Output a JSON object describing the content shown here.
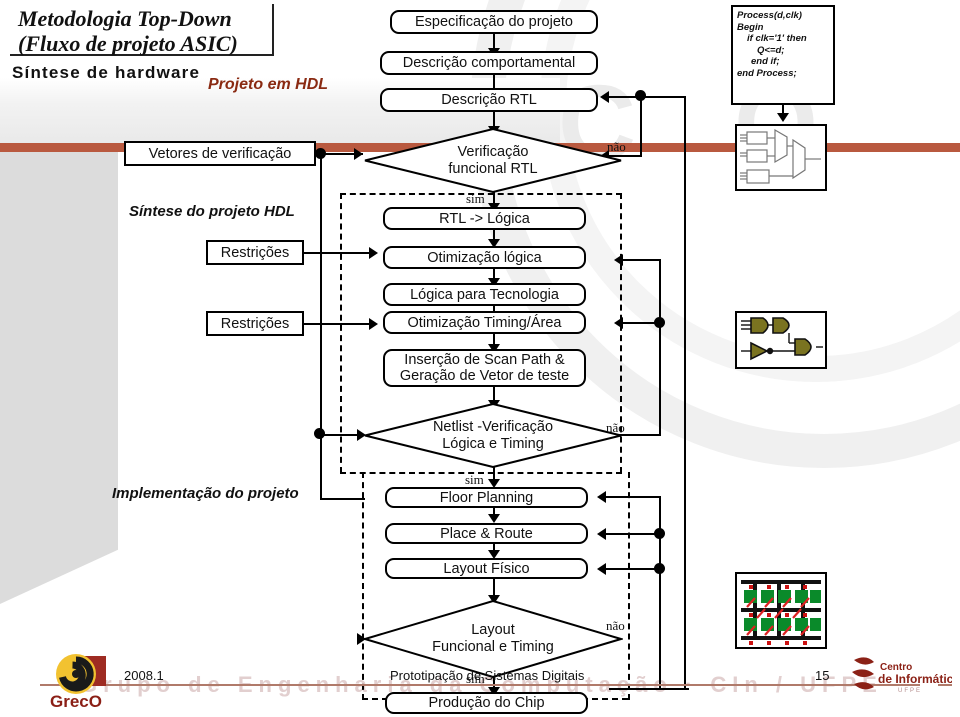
{
  "header": {
    "title_line1": "Metodologia Top-Down",
    "title_line2": "(Fluxo de projeto ASIC)",
    "subtitle": "Síntese de hardware",
    "phase_label": "Projeto em HDL"
  },
  "watermark": {
    "letters": "GRECO",
    "bottom_line": "Grupo  de  Engenharia  da  Computação · CIn / UFPE"
  },
  "side_labels": {
    "sintese": "Síntese do projeto HDL",
    "implementacao": "Implementação do projeto"
  },
  "flow": {
    "especificacao": "Especificação do projeto",
    "descricao_comportamental": "Descrição comportamental",
    "descricao_rtl": "Descrição RTL",
    "vetores": "Vetores de verificação",
    "verificacao_rtl_l1": "Verificação",
    "verificacao_rtl_l2": "funcional RTL",
    "rtl_logica": "RTL -> Lógica",
    "restricoes_1": "Restrições",
    "otimizacao_logica": "Otimização lógica",
    "logica_tecnologia": "Lógica para Tecnologia",
    "restricoes_2": "Restrições",
    "otimizacao_timing": "Otimização Timing/Área",
    "scan_path_l1": "Inserção de Scan Path &",
    "scan_path_l2": "Geração de Vetor de teste",
    "netlist_l1": "Netlist -Verificação",
    "netlist_l2": "Lógica e Timing",
    "floor_planning": "Floor Planning",
    "place_route": "Place & Route",
    "layout_fisico": "Layout Físico",
    "layout_func_l1": "Layout",
    "layout_func_l2": "Funcional e Timing",
    "producao_chip": "Produção do Chip"
  },
  "edge_labels": {
    "nao_1": "não",
    "sim_1": "sim",
    "nao_2": "não",
    "sim_2": "sim",
    "nao_3": "não",
    "sim_3": "sim"
  },
  "code": {
    "l1": "Process(d,clk)",
    "l2": "Begin",
    "l3": "if clk='1' then",
    "l4": "Q<=d;",
    "l5": "end if;",
    "l6": "end Process;"
  },
  "thumbs": {
    "rtl_schematic": "rtl-schematic-thumbnail",
    "gate_netlist": "gate-netlist-thumbnail",
    "chip_layout": "chip-layout-thumbnail"
  },
  "footer": {
    "date": "2008.1",
    "course": "Prototipação de Sistemas Digitais",
    "page": "15",
    "greco_logo": "greco-logo",
    "cin_logo": "cin-logo",
    "greco_name": "GrecO",
    "cin_name_1": "Centro",
    "cin_name_2": "de Informática"
  },
  "colors": {
    "accent_bar": "#b9593f",
    "phase_text": "#8a2a12",
    "gate_fill": "#7a7320",
    "chip_green": "#0a8a2a",
    "chip_red": "#cc1111"
  }
}
